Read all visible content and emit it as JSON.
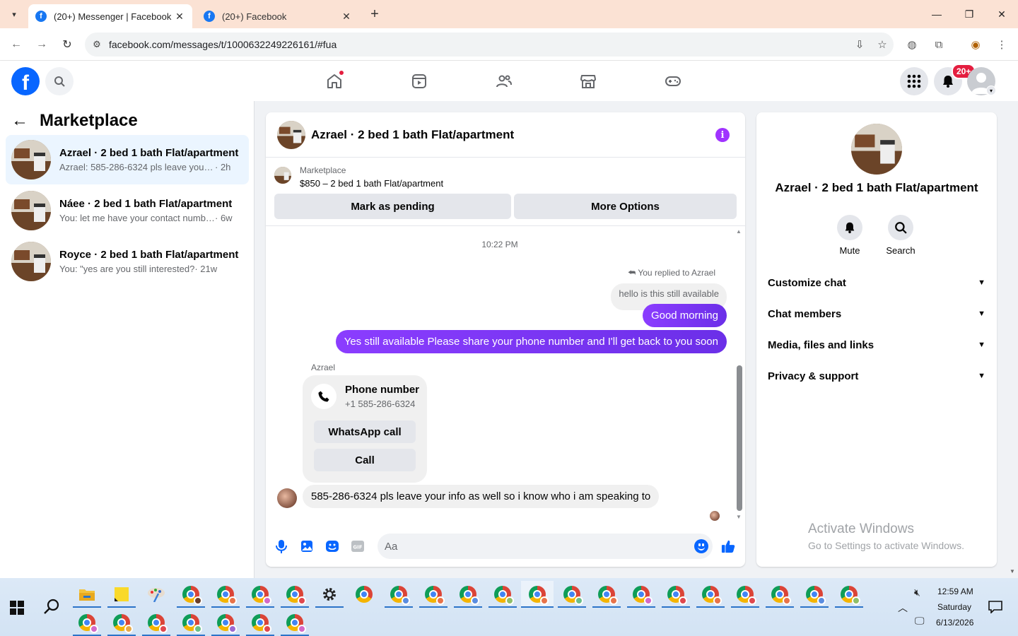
{
  "browser": {
    "tabs": [
      {
        "title": "(20+) Messenger | Facebook",
        "active": true
      },
      {
        "title": "(20+) Facebook",
        "active": false
      }
    ],
    "url": "facebook.com/messages/t/1000632249226161/#fua"
  },
  "header": {
    "notification_badge": "20+"
  },
  "sidebar": {
    "title": "Marketplace",
    "conversations": [
      {
        "name": "Azrael · 2 bed 1 bath Flat/apartment",
        "preview": "Azrael: 585-286-6324 pls leave your in...",
        "time": "· 2h",
        "active": true
      },
      {
        "name": "Náee · 2 bed 1 bath Flat/apartment",
        "preview": "You: let me have your contact numbe...",
        "time": "· 6w",
        "active": false
      },
      {
        "name": "Royce · 2 bed 1 bath Flat/apartment",
        "preview": "You: \"yes are you still interested?",
        "time": "· 21w",
        "active": false
      }
    ]
  },
  "chat": {
    "title": "Azrael · 2 bed 1 bath Flat/apartment",
    "marketplace_label": "Marketplace",
    "listing": "$850 – 2 bed 1 bath Flat/apartment",
    "mark_pending": "Mark as pending",
    "more_options": "More Options",
    "timestamp": "10:22 PM",
    "reply_note": "You replied to Azrael",
    "quoted_text": "hello is this still available",
    "outgoing": [
      "Good morning",
      "Yes still available Please share your phone number and I'll get back to you soon"
    ],
    "sender_name": "Azrael",
    "phone_card": {
      "title": "Phone number",
      "number": "+1 585-286-6324",
      "whatsapp": "WhatsApp call",
      "call": "Call"
    },
    "incoming": "585-286-6324 pls leave your info as well so i know who i am speaking to",
    "composer_placeholder": "Aa"
  },
  "details": {
    "name": "Azrael · 2 bed 1 bath Flat/apartment",
    "actions": [
      {
        "label": "Mute",
        "icon": "bell-icon"
      },
      {
        "label": "Search",
        "icon": "search-icon"
      }
    ],
    "sections": [
      "Customize chat",
      "Chat members",
      "Media, files and links",
      "Privacy & support"
    ]
  },
  "watermark": {
    "line1": "Activate Windows",
    "line2": "Go to Settings to activate Windows."
  },
  "taskbar": {
    "time": "12:59 AM",
    "day": "Saturday",
    "date": "6/13/2026"
  },
  "colors": {
    "facebook_blue": "#0866ff",
    "messenger_purple": "#8b3dff",
    "badge_red": "#e41e3f",
    "active_row": "#ebf5ff"
  }
}
